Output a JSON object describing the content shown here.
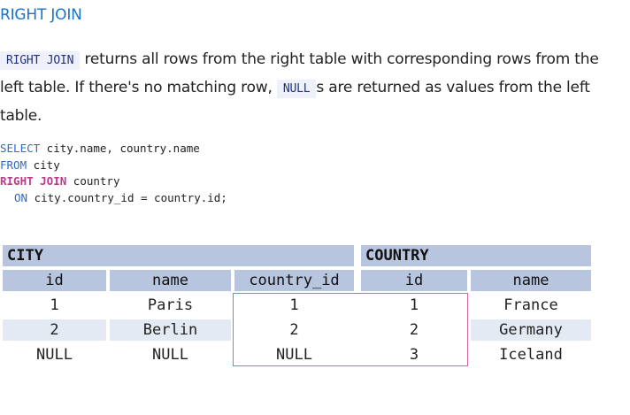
{
  "heading": "RIGHT JOIN",
  "paragraph": {
    "kw1": "RIGHT JOIN",
    "text1": " returns all rows from the right table with corresponding rows from the left table. If there's no matching row, ",
    "kw2": "NULL",
    "text2": "s are returned as values from the left table."
  },
  "code": {
    "line1_kw": "SELECT",
    "line1_rest": " city.name, country.name",
    "line2_kw": "FROM",
    "line2_rest": " city",
    "line3_kw": "RIGHT JOIN",
    "line3_rest": " country",
    "line4_kw": "ON",
    "line4_rest": " city.country_id = country.id;"
  },
  "tables": {
    "city_title": "CITY",
    "country_title": "COUNTRY",
    "headers": [
      "id",
      "name",
      "country_id",
      "id",
      "name"
    ],
    "rows": [
      [
        "1",
        "Paris",
        "1",
        "1",
        "France"
      ],
      [
        "2",
        "Berlin",
        "2",
        "2",
        "Germany"
      ],
      [
        "NULL",
        "NULL",
        "NULL",
        "3",
        "Iceland"
      ]
    ]
  },
  "colors": {
    "heading": "#1a73c8",
    "header_bg": "#b7c5df",
    "stripe_bg": "#e4eaf4",
    "match_box": "#d4659c",
    "sql_keyword": "#2b6cc4",
    "sql_join": "#c0388a"
  }
}
